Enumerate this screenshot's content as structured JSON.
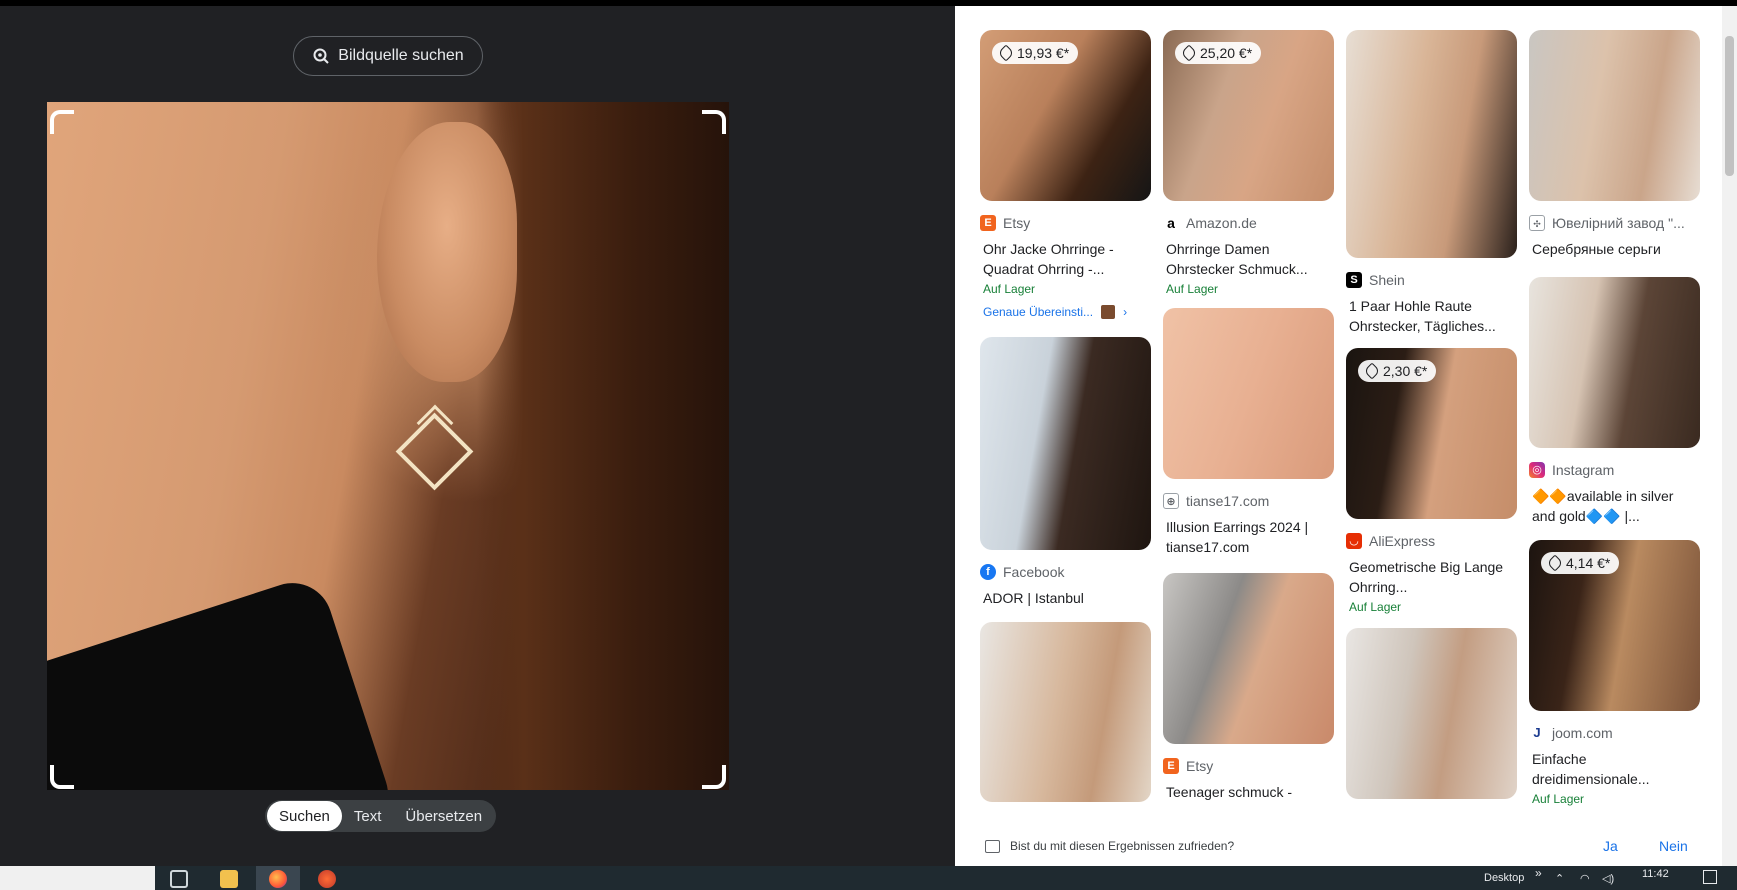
{
  "left": {
    "source_button": "Bildquelle suchen",
    "tabs": [
      {
        "label": "Suchen",
        "active": true
      },
      {
        "label": "Text",
        "active": false
      },
      {
        "label": "Übersetzen",
        "active": false
      }
    ]
  },
  "results": {
    "col1": [
      {
        "price": "19,93 €*",
        "source": "Etsy",
        "title": "Ohr Jacke Ohrringe - Quadrat Ohrring -...",
        "stock": "Auf Lager",
        "exact": "Genaue Übereinsti..."
      },
      {
        "source": "Facebook",
        "title": "ADOR | Istanbul"
      },
      {}
    ],
    "col2": [
      {
        "price": "25,20 €*",
        "source": "Amazon.de",
        "title": "Ohrringe Damen Ohrstecker Schmuck...",
        "stock": "Auf Lager"
      },
      {
        "source": "tianse17.com",
        "title": "Illusion Earrings 2024 | tianse17.com"
      },
      {
        "source": "Etsy",
        "title": "Teenager schmuck -"
      }
    ],
    "col3": [
      {
        "source": "Shein",
        "title": "1 Paar Hohle Raute Ohrstecker, Tägliches..."
      },
      {
        "price": "2,30 €*",
        "source": "AliExpress",
        "title": "Geometrische Big Lange Ohrring...",
        "stock": "Auf Lager"
      },
      {}
    ],
    "col4": [
      {
        "source": "Ювелірний завод \"...",
        "title": "Серебряные серьги"
      },
      {
        "source": "Instagram",
        "title": "🔶🔶available in silver and gold🔷🔷 |..."
      },
      {
        "price": "4,14 €*",
        "source": "joom.com",
        "title": "Einfache dreidimensionale...",
        "stock": "Auf Lager"
      }
    ]
  },
  "feedback": {
    "question": "Bist du mit diesen Ergebnissen zufrieden?",
    "yes": "Ja",
    "no": "Nein"
  },
  "taskbar": {
    "desktop_label": "Desktop",
    "time": "11:42"
  }
}
